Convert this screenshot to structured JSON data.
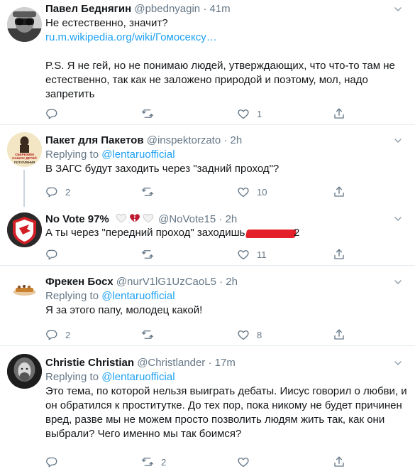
{
  "tweets": [
    {
      "name": "Павел Беднягин",
      "handle": "@pbednyagin",
      "time": "41m",
      "text_line1": "Не естественно, значит?",
      "link": "ru.m.wikipedia.org/wiki/Гомосексу…",
      "text_para2": "P.S. Я не гей, но не понимаю людей, утверждающих, что что-то там не естественно, так как не заложено природой и поэтому, мол, надо запретить",
      "replies": "",
      "retweets": "",
      "likes": "1"
    },
    {
      "name": "Пакет для Пакетов",
      "handle": "@inspektorzato",
      "time": "2h",
      "replying_prefix": "Replying to",
      "replying_to": "@lentaruofficial",
      "text": "В ЗАГС будут заходить через \"задний проход\"?",
      "replies": "2",
      "retweets": "",
      "likes": "10",
      "avatar_text": [
        "СБЕРЕЖЁМ",
        "НАШИХ ДЕТЕЙ",
        "ПОТУПЛЕНИЯ"
      ]
    },
    {
      "name": "No Vote 97%",
      "handle": "@NoVote15",
      "time": "2h",
      "text": "А ты через \"передний проход\" заходишь,",
      "text_tail": "2",
      "replies": "",
      "retweets": "",
      "likes": "11"
    },
    {
      "name": "Фрекен Босх",
      "handle": "@nurV1lG1UzCaoL5",
      "time": "2h",
      "replying_prefix": "Replying to",
      "replying_to": "@lentaruofficial",
      "text": "Я за этого папу, молодец какой!",
      "replies": "2",
      "retweets": "",
      "likes": "8"
    },
    {
      "name": "Christie Christian",
      "handle": "@Christlander",
      "time": "17m",
      "replying_prefix": "Replying to",
      "replying_to": "@lentaruofficial",
      "text": "Это тема, по которой нельзя выиграть дебаты. Иисус говорил о любви, и он обратился к проститутке. До тех пор, пока никому не будет причинен вред, разве мы не можем просто позволить людям жить так, как они выбрали? Чего именно мы так боимся?",
      "replies": "",
      "retweets": "2",
      "likes": ""
    }
  ],
  "colors": {
    "link": "#1da1f2",
    "muted": "#657786",
    "text": "#14171a",
    "divider": "#e6ecf0",
    "broken_heart": "#be1931"
  },
  "icons": [
    "reply-icon",
    "retweet-icon",
    "like-icon",
    "share-icon",
    "chevron-down-icon"
  ]
}
